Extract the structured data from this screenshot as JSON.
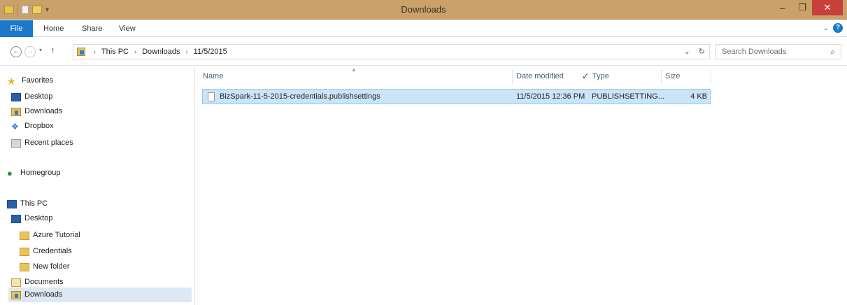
{
  "window": {
    "title": "Downloads",
    "minimize_glyph": "–",
    "maximize_glyph": "❐",
    "close_glyph": "✕"
  },
  "ribbon": {
    "tabs": [
      "File",
      "Home",
      "Share",
      "View"
    ],
    "expand_glyph": "⌄",
    "help_glyph": "?"
  },
  "navigation": {
    "back_glyph": "←",
    "forward_glyph": "→",
    "recent_glyph": "▾",
    "up_glyph": "↑"
  },
  "address": {
    "crumbs": [
      "This PC",
      "Downloads",
      "11/5/2015"
    ],
    "separator": "›",
    "dropdown_glyph": "⌄",
    "refresh_glyph": "↻"
  },
  "search": {
    "placeholder": "Search Downloads",
    "icon_glyph": "⌕"
  },
  "sidebar": {
    "favorites_label": "Favorites",
    "favorites": [
      "Desktop",
      "Downloads",
      "Dropbox",
      "Recent places"
    ],
    "homegroup_label": "Homegroup",
    "thispc_label": "This PC",
    "thispc_items": [
      "Desktop",
      "Azure Tutorial",
      "Credentials",
      "New folder",
      "Documents",
      "Downloads"
    ],
    "selected_item": "Downloads"
  },
  "file_list": {
    "columns": {
      "name": "Name",
      "date_modified": "Date modified",
      "type": "Type",
      "size": "Size"
    },
    "sort_glyph": "▲",
    "column_check_glyph": "✓",
    "rows": [
      {
        "name": "BizSpark-11-5-2015-credentials.publishsettings",
        "date_modified": "11/5/2015 12:36 PM",
        "type": "PUBLISHSETTING...",
        "size": "4 KB",
        "selected": true
      }
    ]
  },
  "colors": {
    "title_bar": "#c9a26b",
    "file_tab": "#1979ca",
    "close_button": "#c7403a",
    "selection": "#cce4f7"
  },
  "icons": {
    "favorites": "star-icon",
    "desktop": "desktop-icon",
    "downloads": "downloads-folder-icon",
    "dropbox": "dropbox-icon",
    "recent_places": "recent-places-icon",
    "homegroup": "homegroup-icon",
    "this_pc": "computer-icon",
    "folder": "folder-icon",
    "documents": "documents-icon",
    "file": "file-icon",
    "search": "search-icon"
  }
}
